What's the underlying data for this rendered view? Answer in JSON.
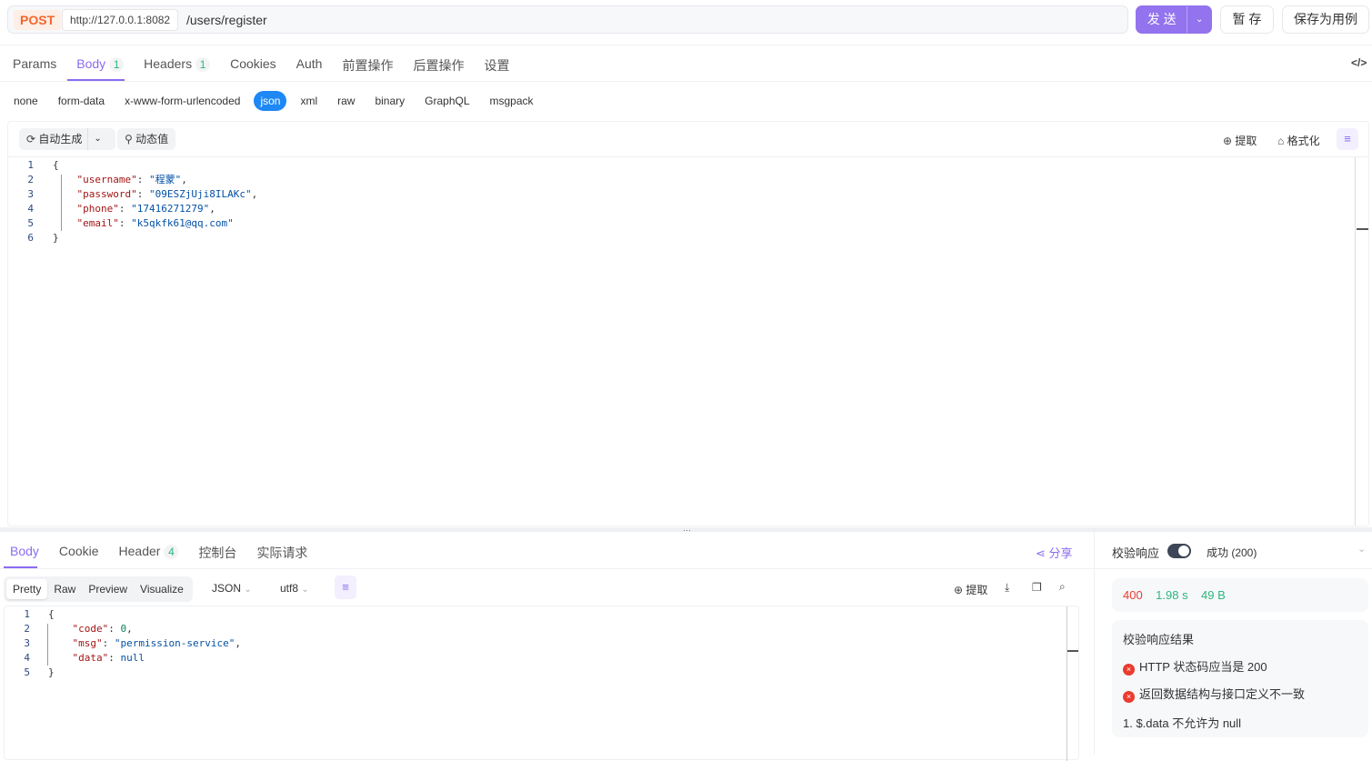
{
  "request": {
    "method": "POST",
    "base_url": "http://127.0.0.1:8082",
    "path": "/users/register",
    "send_label": "发 送",
    "save_draft_label": "暂 存",
    "save_case_label": "保存为用例"
  },
  "request_tabs": [
    {
      "label": "Params",
      "count": null
    },
    {
      "label": "Body",
      "count": "1"
    },
    {
      "label": "Headers",
      "count": "1"
    },
    {
      "label": "Cookies",
      "count": null
    },
    {
      "label": "Auth",
      "count": null
    },
    {
      "label": "前置操作",
      "count": null
    },
    {
      "label": "后置操作",
      "count": null
    },
    {
      "label": "设置",
      "count": null
    }
  ],
  "body_types": [
    "none",
    "form-data",
    "x-www-form-urlencoded",
    "json",
    "xml",
    "raw",
    "binary",
    "GraphQL",
    "msgpack"
  ],
  "body_type_selected": "json",
  "editor_toolbar": {
    "auto_generate": "自动生成",
    "dynamic_value": "动态值",
    "extract": "提取",
    "format": "格式化"
  },
  "request_body": {
    "lines": [
      "1",
      "2",
      "3",
      "4",
      "5",
      "6"
    ],
    "username_key": "\"username\"",
    "username_val": "\"程蒙\"",
    "password_key": "\"password\"",
    "password_val": "\"09ESZjUji8ILAKc\"",
    "phone_key": "\"phone\"",
    "phone_val": "\"17416271279\"",
    "email_key": "\"email\"",
    "email_val": "\"k5qkfk61@qq.com\""
  },
  "response_tabs": [
    {
      "label": "Body",
      "count": null
    },
    {
      "label": "Cookie",
      "count": null
    },
    {
      "label": "Header",
      "count": "4"
    },
    {
      "label": "控制台",
      "count": null
    },
    {
      "label": "实际请求",
      "count": null
    }
  ],
  "share_label": "分享",
  "view_modes": [
    "Pretty",
    "Raw",
    "Preview",
    "Visualize"
  ],
  "format_select": "JSON",
  "encoding_select": "utf8",
  "response_extract": "提取",
  "response_body": {
    "code_key": "\"code\"",
    "code_val": "0",
    "msg_key": "\"msg\"",
    "msg_val": "\"permission-service\"",
    "data_key": "\"data\"",
    "data_val": "null"
  },
  "validation": {
    "label": "校验响应",
    "enabled": true,
    "expected": "成功 (200)",
    "status": "400",
    "time": "1.98 s",
    "size": "49 B",
    "result_title": "校验响应结果",
    "errors": [
      "HTTP 状态码应当是 200",
      "返回数据结构与接口定义不一致"
    ],
    "detail": "1. $.data 不允许为 null"
  },
  "colors": {
    "accent": "#9373ee",
    "method": "#f2662b",
    "error": "#ea3b2f",
    "success": "#2cb67d"
  }
}
